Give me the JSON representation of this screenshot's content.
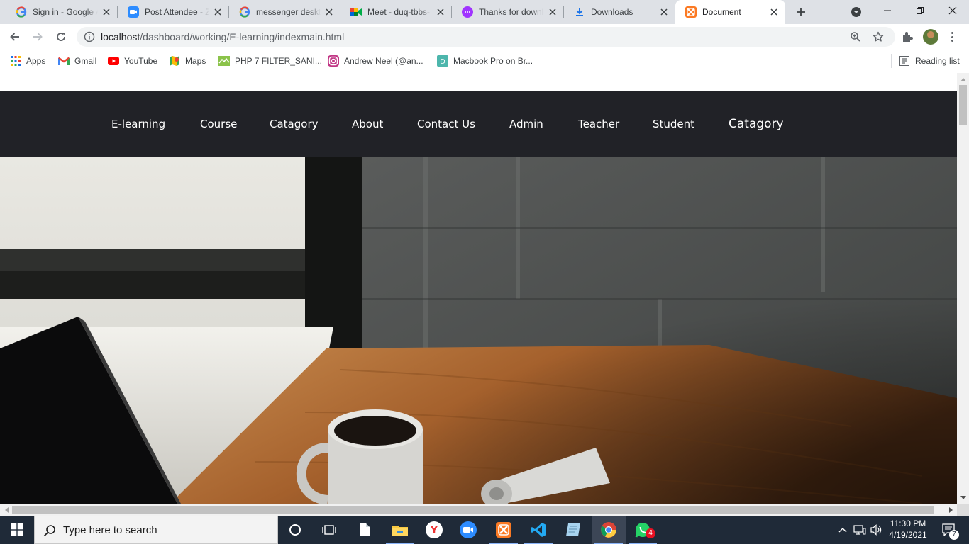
{
  "browser": {
    "tabs": [
      {
        "title": "Sign in - Google Accounts",
        "icon": "google-icon"
      },
      {
        "title": "Post Attendee - Zoom",
        "icon": "zoom-icon"
      },
      {
        "title": "messenger desktop",
        "icon": "google-icon"
      },
      {
        "title": "Meet - duq-tbbs-",
        "icon": "google-meet-icon"
      },
      {
        "title": "Thanks for downloading",
        "icon": "messenger-icon"
      },
      {
        "title": "Downloads",
        "icon": "download-icon"
      },
      {
        "title": "Document",
        "icon": "xampp-icon",
        "active": true
      }
    ],
    "url_host": "localhost",
    "url_path": "/dashboard/working/E-learning/indexmain.html",
    "bookmarks": [
      {
        "label": "Apps",
        "icon": "apps-grid-icon"
      },
      {
        "label": "Gmail",
        "icon": "gmail-icon"
      },
      {
        "label": "YouTube",
        "icon": "youtube-icon"
      },
      {
        "label": "Maps",
        "icon": "maps-icon"
      },
      {
        "label": "PHP 7 FILTER_SANI...",
        "icon": "php-filter-icon"
      },
      {
        "label": "Andrew Neel (@an...",
        "icon": "instagram-icon"
      },
      {
        "label": "Macbook Pro on Br...",
        "icon": "d-bookmark-icon"
      }
    ],
    "reading_list": "Reading list"
  },
  "site": {
    "nav": [
      "E-learning",
      "Course",
      "Catagory",
      "About",
      "Contact Us",
      "Admin",
      "Teacher",
      "Student",
      "Catagory"
    ]
  },
  "taskbar": {
    "search_placeholder": "Type here to search",
    "time": "11:30 PM",
    "date": "4/19/2021",
    "whatsapp_badge": "4",
    "notification_count": "7"
  },
  "colors": {
    "tabstrip": "#dee1e6",
    "site_nav_bg": "#212227",
    "taskbar_bg": "#1f2a38"
  }
}
